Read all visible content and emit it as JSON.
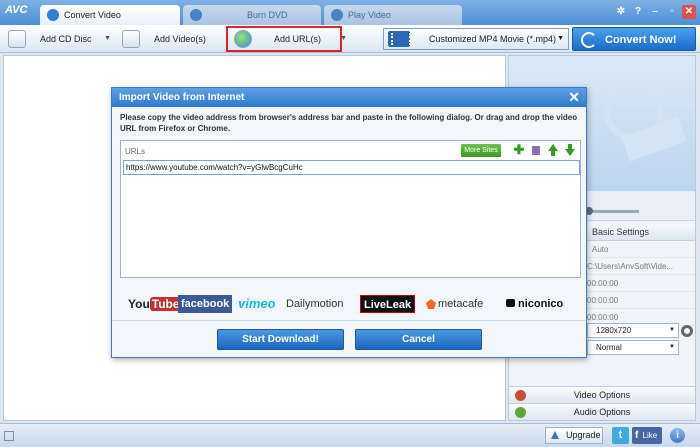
{
  "app": {
    "logo": "AVC",
    "tabs": [
      {
        "label": "Convert Video",
        "active": true
      },
      {
        "label": "Burn DVD",
        "active": false
      },
      {
        "label": "Play Video",
        "active": false
      }
    ]
  },
  "toolbar": {
    "add_cd": "Add CD Disc",
    "add_video": "Add Video(s)",
    "add_url": "Add URL(s)",
    "profile": "Customized MP4 Movie (*.mp4)",
    "convert": "Convert Now!"
  },
  "right_panel": {
    "basic_settings": "Basic Settings",
    "auto": "Auto",
    "path": "C:\\Users\\AnvSoft\\Vide...",
    "time1": "00:00:00",
    "time2": "00:00:00",
    "time3": "00:00:00",
    "resolution": "1280x720",
    "quality": "Normal",
    "video_options": "Video Options",
    "audio_options": "Audio Options"
  },
  "dialog": {
    "title": "Import Video from Internet",
    "instructions": "Please copy the video address from browser's address bar and paste in the following dialog. Or drag and drop the video URL from Firefox or Chrome.",
    "urls_label": "URLs",
    "more_sites": "More Sites",
    "url_value": "https://www.youtube.com/watch?v=yGlwBcgCuHc",
    "logos": {
      "youtube_a": "You",
      "youtube_b": "Tube",
      "facebook": "facebook",
      "vimeo": "vimeo",
      "dailymotion": "Dailymotion",
      "liveleak": "LiveLeak",
      "metacafe": "metacafe",
      "niconico": "niconico"
    },
    "start": "Start Download!",
    "cancel": "Cancel"
  },
  "statusbar": {
    "upgrade": "Upgrade",
    "twitter": "t",
    "like": "Like",
    "fb_f": "f",
    "info": "i"
  },
  "colors": {
    "accent": "#2e78cf",
    "highlight": "#d9262c"
  }
}
